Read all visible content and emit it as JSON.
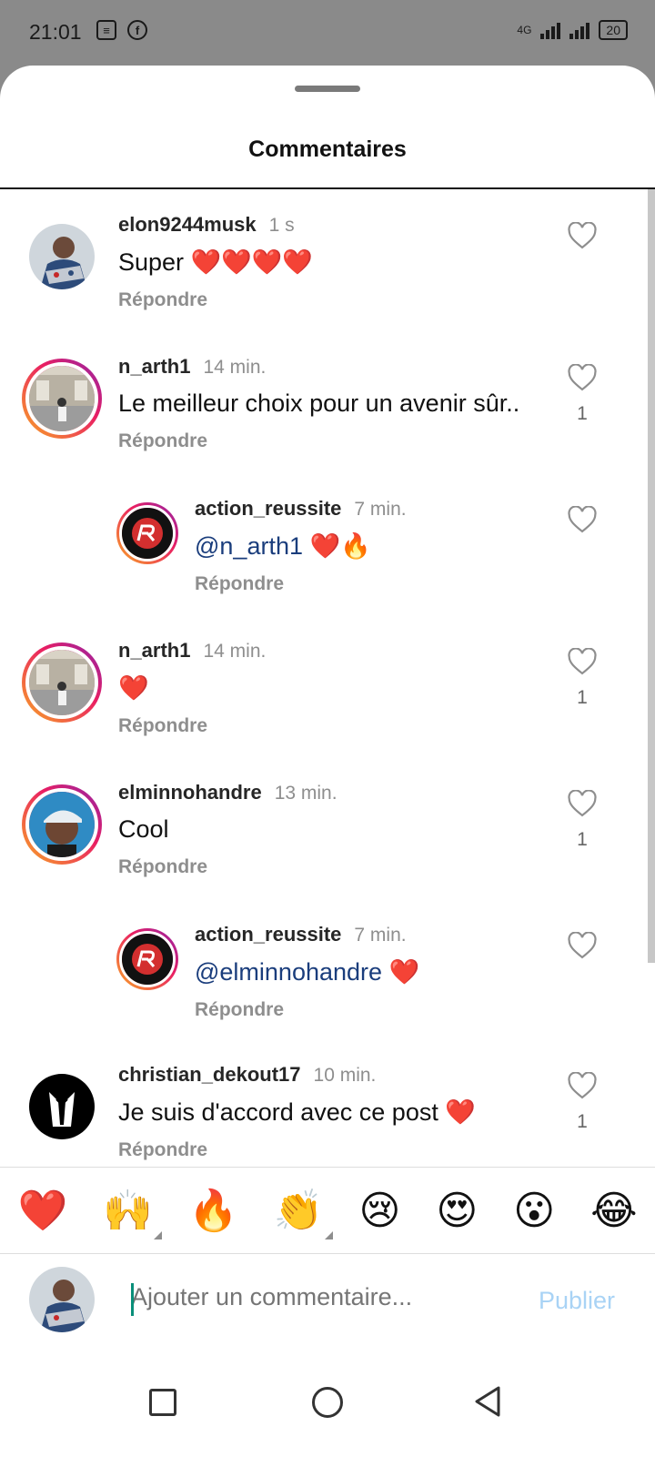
{
  "status_bar": {
    "time": "21:01",
    "network": "4G",
    "battery": "20"
  },
  "sheet": {
    "title": "Commentaires"
  },
  "comments": [
    {
      "user": "elon9244musk",
      "time": "1 s",
      "text": "Super ❤️❤️❤️❤️",
      "reply_label": "Répondre",
      "likes": ""
    },
    {
      "user": "n_arth1",
      "time": "14 min.",
      "text": "Le meilleur choix pour un avenir sûr..",
      "reply_label": "Répondre",
      "likes": "1"
    },
    {
      "user": "action_reussite",
      "time": "7 min.",
      "mention": "@n_arth1",
      "text": " ❤️🔥",
      "reply_label": "Répondre",
      "likes": ""
    },
    {
      "user": "n_arth1",
      "time": "14 min.",
      "text": "❤️",
      "reply_label": "Répondre",
      "likes": "1"
    },
    {
      "user": "elminnohandre",
      "time": "13 min.",
      "text": "Cool",
      "reply_label": "Répondre",
      "likes": "1"
    },
    {
      "user": "action_reussite",
      "time": "7 min.",
      "mention": "@elminnohandre",
      "text": " ❤️",
      "reply_label": "Répondre",
      "likes": ""
    },
    {
      "user": "christian_dekout17",
      "time": "10 min.",
      "text": "Je suis d'accord avec ce post ❤️",
      "reply_label": "Répondre",
      "likes": "1"
    }
  ],
  "emoji_bar": [
    "❤️",
    "🙌",
    "🔥",
    "👏",
    "😢",
    "😍",
    "😮",
    "😂"
  ],
  "composer": {
    "placeholder": "Ajouter un commentaire...",
    "publish_label": "Publier"
  },
  "colors": {
    "mention": "#1a3d7c",
    "publish_disabled": "#a9d3f5",
    "story_ring_start": "#f9a825",
    "story_ring_end": "#8e24aa"
  }
}
